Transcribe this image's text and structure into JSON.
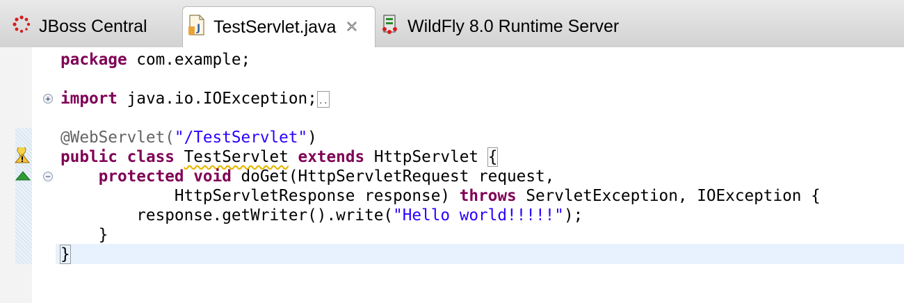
{
  "tabs": [
    {
      "label": "JBoss Central",
      "icon": "jboss-central-icon",
      "active": false
    },
    {
      "label": "TestServlet.java",
      "icon": "java-file-icon",
      "active": true,
      "close": "close-icon"
    },
    {
      "label": "WildFly 8.0 Runtime Server",
      "icon": "server-icon",
      "active": false
    }
  ],
  "code": {
    "line1": {
      "kw": "package",
      "rest": " com.example;"
    },
    "line3": {
      "kw": "import",
      "rest": " java.io.IOException;",
      "folded": ".."
    },
    "line5": {
      "ann": "@WebServlet(",
      "str": "\"/TestServlet\"",
      "tail": ")"
    },
    "line6": {
      "kw1": "public",
      "kw2": "class",
      "name": "TestServlet",
      "kw3": "extends",
      "tail": " HttpServlet ",
      "brace": "{"
    },
    "line7": {
      "indent": "    ",
      "kw1": "protected",
      "kw2": "void",
      "tail": " doGet(HttpServletRequest request,"
    },
    "line8": {
      "indent": "            ",
      "pre": "HttpServletResponse response) ",
      "kw": "throws",
      "tail": " ServletException, IOException {"
    },
    "line9": {
      "pre": "        response.getWriter().write(",
      "str": "\"Hello world!!!!!\"",
      "tail": ");"
    },
    "line10": {
      "text": "    }"
    },
    "line11": {
      "text": "}"
    }
  },
  "colors": {
    "keyword": "#7f0055",
    "string": "#2a00ff",
    "annotation": "#646464",
    "current_line": "#e8f2fe"
  }
}
